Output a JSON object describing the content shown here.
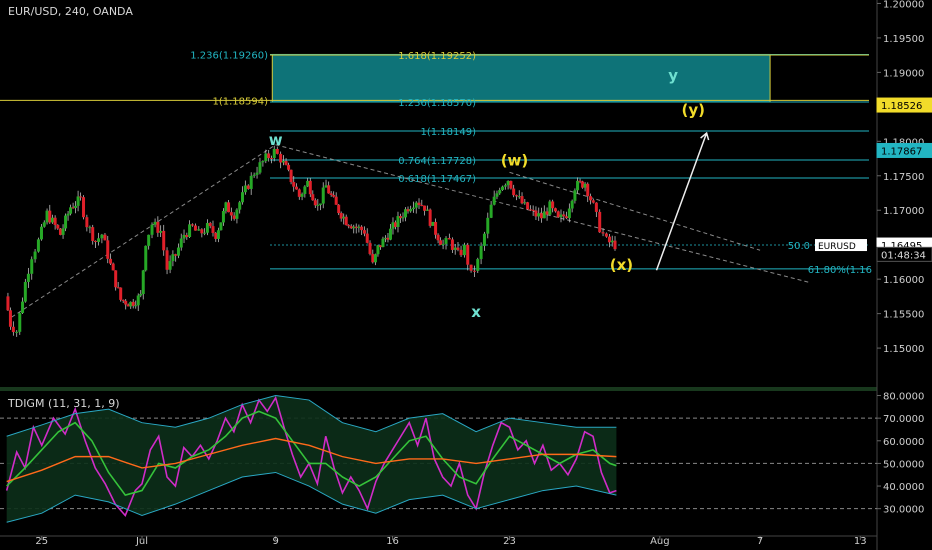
{
  "header": {
    "symbol_title": "EUR/USD, 240, OANDA",
    "indicator_title": "TDIGM (11, 31, 1, 9)"
  },
  "colors": {
    "background": "#000000",
    "up_candle": "#26a826",
    "down_candle": "#e0202a",
    "fib_cyan": "#22b5c2",
    "fib_yellow": "#d8cc3a",
    "box_fill": "#0e7378",
    "wave_label_cyan": "#6fe0d0",
    "wave_label_yellow": "#f2dc2a",
    "rsi": "#d02cc8",
    "fast_line": "#35c23a",
    "slow_line": "#ff6a1a",
    "band": "#2aa8c4"
  },
  "chart_data": [
    {
      "type": "candlestick",
      "title": "EUR/USD, 240, OANDA",
      "ylim": [
        1.1445,
        1.2005
      ],
      "y_ticks": [
        "1.20000",
        "1.19500",
        "1.19000",
        "1.18500",
        "1.18000",
        "1.17500",
        "1.17000",
        "1.16500",
        "1.16000",
        "1.15500",
        "1.15000"
      ],
      "y_tick_values": [
        1.2,
        1.195,
        1.19,
        1.185,
        1.18,
        1.175,
        1.17,
        1.165,
        1.16,
        1.155,
        1.15
      ],
      "x_ticks": [
        "25",
        "Jul",
        "9",
        "16",
        "23",
        "Aug",
        "7",
        "13"
      ],
      "x_tick_days": [
        -6,
        0,
        8,
        15,
        22,
        31,
        37,
        43
      ],
      "x_day_range": [
        -8.5,
        44
      ],
      "price_path": [
        [
          -8.1,
          1.1575
        ],
        [
          -7.8,
          1.1535
        ],
        [
          -7.4,
          1.1525
        ],
        [
          -6.9,
          1.1595
        ],
        [
          -6.5,
          1.1635
        ],
        [
          -6.1,
          1.1655
        ],
        [
          -5.6,
          1.1695
        ],
        [
          -4.8,
          1.1665
        ],
        [
          -4.2,
          1.1705
        ],
        [
          -3.6,
          1.1715
        ],
        [
          -3.2,
          1.168
        ],
        [
          -2.7,
          1.1655
        ],
        [
          -2.3,
          1.1665
        ],
        [
          -1.8,
          1.162
        ],
        [
          -1.2,
          1.157
        ],
        [
          -0.6,
          1.1565
        ],
        [
          0,
          1.1575
        ],
        [
          0.3,
          1.1655
        ],
        [
          0.7,
          1.168
        ],
        [
          1.2,
          1.167
        ],
        [
          1.6,
          1.1615
        ],
        [
          2.1,
          1.1635
        ],
        [
          2.6,
          1.1665
        ],
        [
          3.1,
          1.1675
        ],
        [
          3.5,
          1.1665
        ],
        [
          4.0,
          1.1675
        ],
        [
          4.5,
          1.1665
        ],
        [
          5.1,
          1.1705
        ],
        [
          5.6,
          1.1695
        ],
        [
          6.1,
          1.172
        ],
        [
          6.8,
          1.1755
        ],
        [
          7.5,
          1.1775
        ],
        [
          8.0,
          1.1785
        ],
        [
          8.4,
          1.1775
        ],
        [
          9.0,
          1.1745
        ],
        [
          9.5,
          1.172
        ],
        [
          10.0,
          1.174
        ],
        [
          10.6,
          1.1705
        ],
        [
          11.1,
          1.1735
        ],
        [
          11.7,
          1.1705
        ],
        [
          12.3,
          1.1685
        ],
        [
          12.9,
          1.1675
        ],
        [
          13.4,
          1.167
        ],
        [
          13.9,
          1.162
        ],
        [
          14.2,
          1.1645
        ],
        [
          14.8,
          1.1665
        ],
        [
          15.4,
          1.1685
        ],
        [
          16.0,
          1.1705
        ],
        [
          16.5,
          1.1715
        ],
        [
          17.0,
          1.1705
        ],
        [
          17.5,
          1.1675
        ],
        [
          18.1,
          1.165
        ],
        [
          18.5,
          1.1655
        ],
        [
          19.0,
          1.1635
        ],
        [
          19.4,
          1.1645
        ],
        [
          19.8,
          1.1605
        ],
        [
          20.2,
          1.1625
        ],
        [
          20.6,
          1.1665
        ],
        [
          21.0,
          1.1705
        ],
        [
          21.5,
          1.1735
        ],
        [
          22.0,
          1.1745
        ],
        [
          22.5,
          1.172
        ],
        [
          23.0,
          1.1705
        ],
        [
          23.5,
          1.1695
        ],
        [
          24.0,
          1.169
        ],
        [
          24.5,
          1.1705
        ],
        [
          25.0,
          1.1685
        ],
        [
          25.5,
          1.1695
        ],
        [
          26.0,
          1.1735
        ],
        [
          26.6,
          1.174
        ],
        [
          27.1,
          1.1705
        ],
        [
          27.5,
          1.1675
        ],
        [
          27.9,
          1.1655
        ],
        [
          28.4,
          1.165
        ]
      ],
      "current_price": 1.16495,
      "lines": [
        {
          "label": "1.236(1.19260)",
          "value": 1.1926,
          "color": "#22b5c2"
        },
        {
          "label": "1.618(1.19252)",
          "value": 1.19252,
          "color": "#d8cc3a"
        },
        {
          "label": "1(1.18594)",
          "value": 1.18594,
          "color": "#d8cc3a"
        },
        {
          "label": "1.236(1.18570)",
          "value": 1.1857,
          "color": "#22b5c2"
        },
        {
          "label": "1(1.18149)",
          "value": 1.18149,
          "color": "#22b5c2"
        },
        {
          "label": "0.764(1.17728)",
          "value": 1.17728,
          "color": "#22b5c2"
        },
        {
          "label": "0.618(1.17467)",
          "value": 1.17467,
          "color": "#22b5c2"
        },
        {
          "label": "50.0",
          "value": 1.16495,
          "color": "#22b5c2"
        },
        {
          "label": "61.80%(1.16",
          "value": 1.1615,
          "color": "#22b5c2"
        }
      ],
      "wave_labels": [
        {
          "text": "w",
          "day": 8.0,
          "price": 1.1795,
          "color": "#6fe0d0"
        },
        {
          "text": "(w)",
          "day": 22.3,
          "price": 1.1765,
          "color": "#f2dc2a"
        },
        {
          "text": "x",
          "day": 20.0,
          "price": 1.1545,
          "color": "#6fe0d0"
        },
        {
          "text": "(x)",
          "day": 28.7,
          "price": 1.1613,
          "color": "#f2dc2a"
        },
        {
          "text": "(y)",
          "day": 33.0,
          "price": 1.1838,
          "color": "#f2dc2a"
        },
        {
          "text": "y",
          "day": 31.8,
          "price": 1.1888,
          "color": "#6fe0d0"
        }
      ],
      "target_box": {
        "day_from": 7.8,
        "day_to": 37.6,
        "price_from": 1.1857,
        "price_to": 1.1926
      },
      "price_tags": [
        {
          "text": "1.18526",
          "value": 1.18526,
          "bg": "#f2dc2a",
          "fg": "#000000"
        },
        {
          "text": "1.17867",
          "value": 1.17867,
          "bg": "#22b5c2",
          "fg": "#000000"
        },
        {
          "text": "1.16495",
          "value": 1.16495,
          "bg": "#ffffff",
          "fg": "#000000"
        },
        {
          "text": "01:48:34",
          "value": 1.1636,
          "bg": "#000000",
          "fg": "#dddddd"
        }
      ],
      "legend_tag": {
        "text": "EURUSD",
        "bg": "#ffffff",
        "fg": "#000000"
      }
    },
    {
      "type": "line",
      "title": "TDIGM (11, 31, 1, 9)",
      "ylim": [
        25,
        82
      ],
      "y_ticks": [
        "80.0000",
        "70.0000",
        "60.0000",
        "50.0000",
        "40.0000",
        "30.0000"
      ],
      "y_tick_values": [
        80,
        70,
        60,
        50,
        40,
        30
      ],
      "dashed_levels": [
        70,
        50,
        30
      ],
      "series": [
        {
          "name": "",
          "color": "#d02cc8",
          "values": [
            [
              -8.1,
              38
            ],
            [
              -7.5,
              55
            ],
            [
              -7,
              48
            ],
            [
              -6.5,
              66
            ],
            [
              -6,
              58
            ],
            [
              -5.3,
              70
            ],
            [
              -4.6,
              63
            ],
            [
              -4,
              74
            ],
            [
              -3.4,
              60
            ],
            [
              -2.8,
              48
            ],
            [
              -2.2,
              41
            ],
            [
              -1.6,
              32
            ],
            [
              -1.0,
              27
            ],
            [
              -0.4,
              38
            ],
            [
              0,
              41
            ],
            [
              0.5,
              56
            ],
            [
              1,
              62
            ],
            [
              1.5,
              44
            ],
            [
              2,
              40
            ],
            [
              2.5,
              57
            ],
            [
              3,
              53
            ],
            [
              3.5,
              58
            ],
            [
              4,
              52
            ],
            [
              4.5,
              60
            ],
            [
              5,
              70
            ],
            [
              5.5,
              64
            ],
            [
              6,
              76
            ],
            [
              6.5,
              68
            ],
            [
              7,
              78
            ],
            [
              7.5,
              73
            ],
            [
              8,
              79
            ],
            [
              8.5,
              66
            ],
            [
              9,
              54
            ],
            [
              9.5,
              44
            ],
            [
              10,
              50
            ],
            [
              10.5,
              41
            ],
            [
              11,
              62
            ],
            [
              11.5,
              48
            ],
            [
              12,
              37
            ],
            [
              12.5,
              44
            ],
            [
              13,
              38
            ],
            [
              13.5,
              30
            ],
            [
              14,
              42
            ],
            [
              14.5,
              50
            ],
            [
              15,
              56
            ],
            [
              15.5,
              62
            ],
            [
              16,
              68
            ],
            [
              16.5,
              58
            ],
            [
              17,
              70
            ],
            [
              17.5,
              52
            ],
            [
              18,
              44
            ],
            [
              18.5,
              40
            ],
            [
              19,
              50
            ],
            [
              19.5,
              36
            ],
            [
              20,
              30
            ],
            [
              20.5,
              46
            ],
            [
              21,
              58
            ],
            [
              21.5,
              68
            ],
            [
              22,
              66
            ],
            [
              22.5,
              56
            ],
            [
              23,
              60
            ],
            [
              23.5,
              50
            ],
            [
              24,
              58
            ],
            [
              24.5,
              47
            ],
            [
              25,
              50
            ],
            [
              25.5,
              45
            ],
            [
              26,
              52
            ],
            [
              26.5,
              64
            ],
            [
              27,
              62
            ],
            [
              27.5,
              46
            ],
            [
              28,
              37
            ],
            [
              28.4,
              38
            ]
          ]
        },
        {
          "name": "",
          "color": "#35c23a",
          "values": [
            [
              -8.1,
              40
            ],
            [
              -7,
              48
            ],
            [
              -6,
              56
            ],
            [
              -5,
              64
            ],
            [
              -4,
              68
            ],
            [
              -3,
              60
            ],
            [
              -2,
              46
            ],
            [
              -1,
              36
            ],
            [
              0,
              38
            ],
            [
              1,
              50
            ],
            [
              2,
              48
            ],
            [
              3,
              53
            ],
            [
              4,
              56
            ],
            [
              5,
              62
            ],
            [
              6,
              70
            ],
            [
              7,
              73
            ],
            [
              8,
              70
            ],
            [
              9,
              60
            ],
            [
              10,
              50
            ],
            [
              11,
              50
            ],
            [
              12,
              44
            ],
            [
              13,
              40
            ],
            [
              14,
              44
            ],
            [
              15,
              52
            ],
            [
              16,
              60
            ],
            [
              17,
              62
            ],
            [
              18,
              52
            ],
            [
              19,
              44
            ],
            [
              20,
              41
            ],
            [
              21,
              52
            ],
            [
              22,
              62
            ],
            [
              23,
              58
            ],
            [
              24,
              54
            ],
            [
              25,
              50
            ],
            [
              26,
              54
            ],
            [
              27,
              56
            ],
            [
              28,
              50
            ],
            [
              28.4,
              49
            ]
          ]
        },
        {
          "name": "",
          "color": "#ff6a1a",
          "values": [
            [
              -8.1,
              42
            ],
            [
              -6,
              47
            ],
            [
              -4,
              53
            ],
            [
              -2,
              53
            ],
            [
              0,
              48
            ],
            [
              2,
              50
            ],
            [
              4,
              54
            ],
            [
              6,
              58
            ],
            [
              8,
              61
            ],
            [
              10,
              58
            ],
            [
              12,
              53
            ],
            [
              14,
              50
            ],
            [
              16,
              52
            ],
            [
              18,
              52
            ],
            [
              20,
              50
            ],
            [
              22,
              52
            ],
            [
              24,
              54
            ],
            [
              26,
              54
            ],
            [
              28.4,
              53
            ]
          ]
        },
        {
          "name": "",
          "color": "#2aa8c4",
          "values": [
            [
              -8.1,
              62
            ],
            [
              -6,
              67
            ],
            [
              -4,
              72
            ],
            [
              -2,
              74
            ],
            [
              0,
              68
            ],
            [
              2,
              66
            ],
            [
              4,
              70
            ],
            [
              6,
              76
            ],
            [
              8,
              80
            ],
            [
              10,
              78
            ],
            [
              12,
              68
            ],
            [
              14,
              64
            ],
            [
              16,
              70
            ],
            [
              18,
              72
            ],
            [
              20,
              64
            ],
            [
              22,
              70
            ],
            [
              24,
              68
            ],
            [
              26,
              66
            ],
            [
              28.4,
              66
            ]
          ]
        },
        {
          "name": "",
          "color": "#2aa8c4",
          "values": [
            [
              -8.1,
              24
            ],
            [
              -6,
              28
            ],
            [
              -4,
              36
            ],
            [
              -2,
              33
            ],
            [
              0,
              27
            ],
            [
              2,
              32
            ],
            [
              4,
              38
            ],
            [
              6,
              44
            ],
            [
              8,
              46
            ],
            [
              10,
              40
            ],
            [
              12,
              32
            ],
            [
              14,
              28
            ],
            [
              16,
              34
            ],
            [
              18,
              36
            ],
            [
              20,
              30
            ],
            [
              22,
              34
            ],
            [
              24,
              38
            ],
            [
              26,
              40
            ],
            [
              28.4,
              36
            ]
          ]
        }
      ]
    }
  ]
}
